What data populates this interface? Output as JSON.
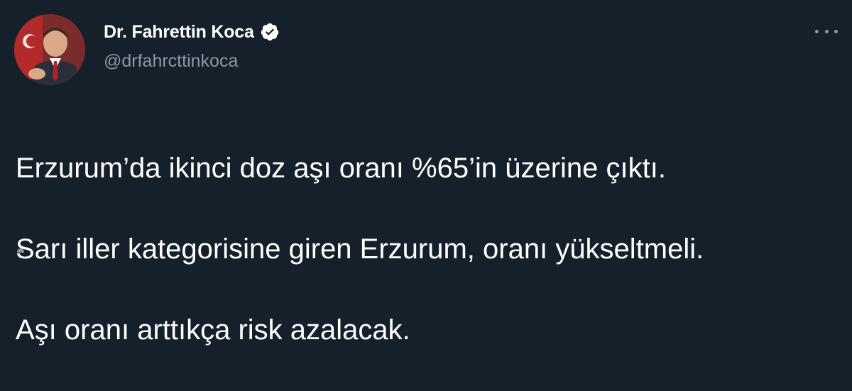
{
  "tweet": {
    "author": {
      "display_name": "Dr. Fahrettin Koca",
      "handle": "@drfahrcttinkoca",
      "verified": true,
      "avatar_icon": "profile-photo"
    },
    "text_lines": [
      "Erzurum’da ikinci doz aşı oranı %65’in üzerine çıktı.",
      "Sarı iller kategorisine giren Erzurum, oranı yükseltmeli.",
      "Aşı oranı arttıkça risk azalacak."
    ],
    "more_icon": "more-dots-icon"
  },
  "colors": {
    "background": "#15202b",
    "text_primary": "#ffffff",
    "text_secondary": "#8b98a5",
    "verified_badge": "#ffffff"
  }
}
